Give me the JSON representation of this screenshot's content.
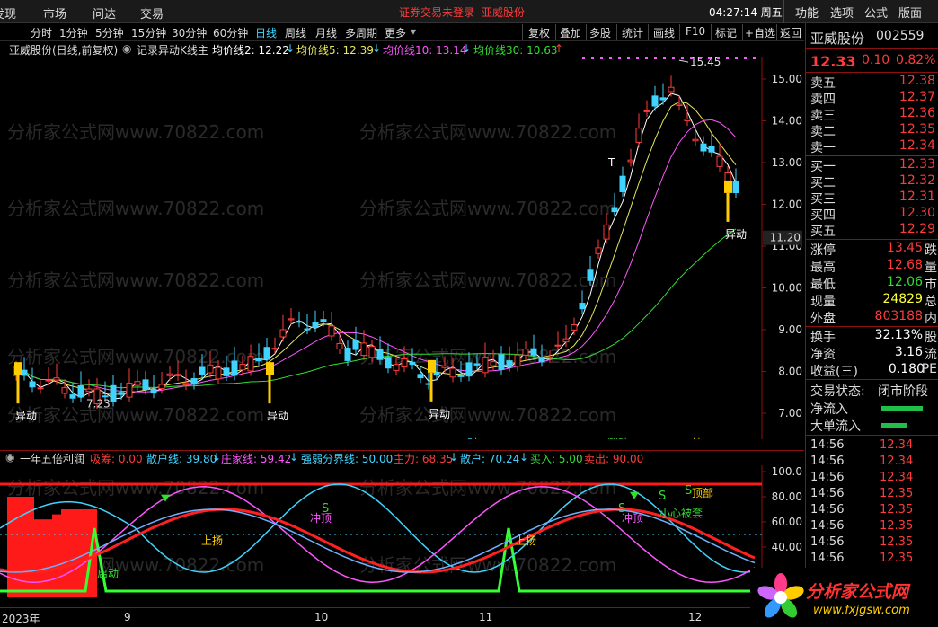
{
  "menu": {
    "left_items": [
      "发现",
      "市场",
      "问达",
      "交易"
    ],
    "warning": "证券交易未登录",
    "stock_title": "亚威股份",
    "time": "04:27:14 周五",
    "right_items": [
      "功能",
      "选项",
      "公式",
      "版面"
    ]
  },
  "periods": {
    "items": [
      "分时",
      "1分钟",
      "5分钟",
      "15分钟",
      "30分钟",
      "60分钟",
      "日线",
      "周线",
      "月线",
      "多周期",
      "更多"
    ],
    "active": "日线"
  },
  "toolbar": [
    "复权",
    "叠加",
    "多股",
    "统计",
    "画线",
    "F10",
    "标记",
    "+自选",
    "返回"
  ],
  "ma_legend": {
    "stock": "亚威股份(日线,前复权)",
    "formula": "记录异动K线主",
    "items": [
      {
        "text": "均价线2: 12.22",
        "arrow": "↓",
        "color": "#ffffff",
        "arrow_color": "#3fd3ff"
      },
      {
        "text": "均价线5: 12.39",
        "arrow": "↓",
        "color": "#e8e85a",
        "arrow_color": "#3fd3ff"
      },
      {
        "text": "均价线10: 13.14",
        "arrow": "↓",
        "color": "#ff55ff",
        "arrow_color": "#3fd3ff"
      },
      {
        "text": "均价线30: 10.63",
        "arrow": "↑",
        "color": "#33dd33",
        "arrow_color": "#ff3b3b"
      }
    ]
  },
  "kline_axis": {
    "labels": [
      "15.00",
      "14.00",
      "13.00",
      "12.00",
      "11.00",
      "10.00",
      "9.00",
      "8.00",
      "7.00"
    ],
    "cursor_price": "11.20"
  },
  "kline_annotations": {
    "high": "15.45",
    "low": "7.23",
    "signal": "异动",
    "t_marker": "T",
    "badges": [
      "财",
      "涨跌",
      "榜"
    ]
  },
  "indicator_legend": {
    "name": "一年五倍利润",
    "items": [
      {
        "text": "吸筹: 0.00",
        "color": "#ff3b3b"
      },
      {
        "text": "散户线: 39.80",
        "color": "#3fd3ff",
        "arrow": "↓"
      },
      {
        "text": "庄家线: 59.42",
        "color": "#ff55ff",
        "arrow": "↓"
      },
      {
        "text": "强弱分界线: 50.00",
        "color": "#3fd3ff"
      },
      {
        "text": "主力: 68.35",
        "color": "#ff3b3b",
        "arrow": "↓"
      },
      {
        "text": "散户: 70.24",
        "color": "#3fd3ff",
        "arrow": "↓"
      },
      {
        "text": "买入: 5.00",
        "color": "#33dd33"
      },
      {
        "text": "卖出: 90.00",
        "color": "#ff3b3b"
      }
    ]
  },
  "indicator_axis": [
    "100.0",
    "80.00",
    "60.00",
    "40.00",
    "20.00"
  ],
  "indicator_annotations": {
    "rise": "上扬",
    "peak": "冲顶",
    "careful": "小心被套",
    "top": "顶部",
    "start": "启动",
    "s": "S"
  },
  "xaxis": [
    "2023年",
    "9",
    "10",
    "11",
    "12"
  ],
  "quote": {
    "name": "亚威股份",
    "code": "002559",
    "price": "12.33",
    "change": "0.10",
    "pct": "0.82%",
    "asks": [
      {
        "k": "卖五",
        "v": "12.38"
      },
      {
        "k": "卖四",
        "v": "12.37"
      },
      {
        "k": "卖三",
        "v": "12.36"
      },
      {
        "k": "卖二",
        "v": "12.35"
      },
      {
        "k": "卖一",
        "v": "12.34"
      }
    ],
    "bids": [
      {
        "k": "买一",
        "v": "12.33"
      },
      {
        "k": "买二",
        "v": "12.32"
      },
      {
        "k": "买三",
        "v": "12.31"
      },
      {
        "k": "买四",
        "v": "12.30"
      },
      {
        "k": "买五",
        "v": "12.29"
      }
    ],
    "stats": [
      {
        "k": "涨停",
        "v": "13.45",
        "e": "跌",
        "color": "#ff3b3b"
      },
      {
        "k": "最高",
        "v": "12.68",
        "e": "量",
        "color": "#ff3b3b"
      },
      {
        "k": "最低",
        "v": "12.06",
        "e": "市",
        "color": "#33dd33"
      },
      {
        "k": "现量",
        "v": "24829",
        "e": "总",
        "color": "#ffff33"
      },
      {
        "k": "外盘",
        "v": "803188",
        "e": "内",
        "color": "#ff3b3b"
      }
    ],
    "stats2": [
      {
        "k": "换手",
        "v": "32.13%",
        "e": "股",
        "color": "#ffffff"
      },
      {
        "k": "净资",
        "v": "3.16",
        "e": "流",
        "color": "#ffffff"
      },
      {
        "k": "收益(三)",
        "v": "0.180",
        "e": "PE",
        "color": "#ffffff"
      }
    ],
    "status_label": "交易状态:",
    "status_value": "闭市阶段",
    "flows": [
      "净流入",
      "大单流入"
    ],
    "ticks": [
      {
        "t": "14:56",
        "p": "12.34"
      },
      {
        "t": "14:56",
        "p": "12.34"
      },
      {
        "t": "14:56",
        "p": "12.34"
      },
      {
        "t": "14:56",
        "p": "12.35"
      },
      {
        "t": "14:56",
        "p": "12.35"
      },
      {
        "t": "14:56",
        "p": "12.35"
      },
      {
        "t": "14:56",
        "p": "12.35"
      },
      {
        "t": "14:56",
        "p": "12.35"
      }
    ]
  },
  "watermark": "分析家公式网www.70822.com",
  "logo": {
    "title": "分析家公式网",
    "url": "www.fxjgsw.com"
  }
}
